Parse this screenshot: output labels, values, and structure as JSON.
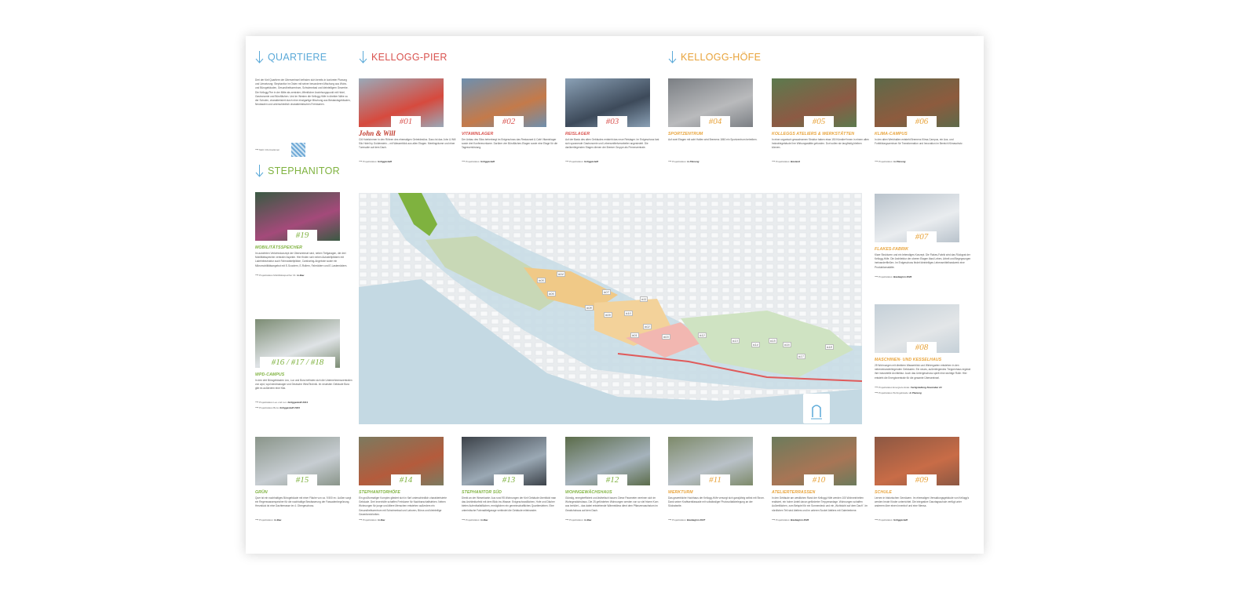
{
  "sections": {
    "quartiere": "QUARTIERE",
    "stephanitor": "STEPHANITOR",
    "kellogg_pier": "KELLOGG-PIER",
    "kellogg_hoefe": "KELLOGG-HÖFE"
  },
  "intro": {
    "text": "Drei der fünf Quartiere der Überseeinsel befinden sich bereits in konkreter Planung und Umsetzung: Stephanitor im Osten mit seiner besonderen Mischung aus Wohn- und Bürogebäuden, Gesundheitszentrum, Schwimmbad und kleinteiligem Gewerbe. Die Kellogg-Pier in der Mitte als zentraler, öffentlicher Anziehungspunkt mit Hotel, Gastronomie und Büroflächen. Und im Westen die Kellogg-Höfe in direkter Nähe zu der Schulen, charakterisiert durch eine einzigartige Mischung aus Bestandsgebäuden, Neubauten und unterschiedlich charakteristischen Freiräumen.",
    "more": "Mehr Informationen"
  },
  "projects": [
    {
      "num": "#01",
      "title": "John & Will",
      "logo": true,
      "desc": "Citi Hotelzimmer in den Röhren des ehemaligen Getreidesilos. Dazu ist das John & Will Silo Hotel by Goldenstein – mit Wasserblick aus allen Etagen. Meetingräume und einer Turmsuite auf dem Dach.",
      "status_label": "Projektstatus:",
      "status": "fertiggestellt"
    },
    {
      "num": "#02",
      "title": "VITAMINLAGER",
      "desc": "Der Anbau des Silos beherbergt im Erdgeschoss das Restaurant & Café Vitaminlager sowie drei Konferenzräume. Darüber vier Büroflächen-Etagen sowie eine Etage für die Tagesverköstung.",
      "status_label": "Projektstatus:",
      "status": "fertiggestellt"
    },
    {
      "num": "#03",
      "title": "REISLAGER",
      "desc": "Auf der Basis des alten Gebäudes entsteht das neue Reislager. Im Erdgeschoss fast sich spannende Gastronomie und Lebensmittelverarbeiter angesiedelt. Die darüberliegenden Etagen dienen der Bremer Gruppe als Firmenzentrale.",
      "status_label": "Projektstatus:",
      "status": "fertiggestellt"
    },
    {
      "num": "#04",
      "title": "SPORTZENTRUM",
      "desc": "Auf zwei Etagen mit acht Hallen wird Bremens 1860 ein Sportzentrum betreiben.",
      "status_label": "Projektstatus:",
      "status": "in Planung"
    },
    {
      "num": "#05",
      "title": "KOLLEGGS ATELIERS & WERKSTÄTTEN",
      "desc": "In einer organisch gewachsenen Struktur haben etwa 150 Künstler*innen in einem alten Industriegebäude ihre Wirkungsstätte gefunden. Dort sollen sie langfristig bleiben können.",
      "status_label": "Projektstatus:",
      "status": "Bestand"
    },
    {
      "num": "#06",
      "title": "KLIMA-CAMPUS",
      "desc": "In den alten Werkhallen entsteht Bremens Klima-Campus, ein Aus- und Fortbildungszentrum für Transformation und Innovation im Bereich Klimaschutz.",
      "status_label": "Projektstatus:",
      "status": "in Planung"
    },
    {
      "num": "#07",
      "title": "FLAKES-FABRIK",
      "desc": "Klare Strukturen und ein lebendiges Konzept. Die Flakes-Fabrik wird das Rückgrat der Kellogg-Höfe. Die Architektur der oberen Etagen lässt Leben, Arbeit und Begegnungen ineinanderfließen. Im Erdgeschoss findet kleinteiliges Lebensmittelhandwerk eine Produktionsstätte.",
      "status_label": "Projektstatus:",
      "status": "Baubeginn 2026"
    },
    {
      "num": "#08",
      "title": "MASCHINEN- UND KESSELHAUS",
      "desc": "25 Wohnungen mit direktem Wasserblick und Wintergarten entstehen in den nebeneinanderliegenden Gebäuden. Ein neues, außenliegendes Treppenhaus ergänzt ihre industrielle Architektur. Auch das Untergeschoss spielt eine wichtige Rolle: Hier entsteht die Energiezentrale für die gesamte Überseeinsel.",
      "status_label": "Projektstatus Energiezentrale:",
      "status": "Fertigstellung November 24",
      "status2_label": "Projektstatus Wohngebäude:",
      "status2": "in Planung"
    },
    {
      "num": "#09",
      "title": "SCHULE",
      "desc": "Lernen in historischen Gemäuern. Im ehemaligen Verwaltungsgebäude von Kellogg's werden heute Kinder unterrichtet. Die integrative Ganztagsschule verfügt unter anderem über einen Innenhof und eine Mensa.",
      "status_label": "Projektstatus:",
      "status": "fertiggestellt"
    },
    {
      "num": "#10",
      "title": "ATELIERTERRASSEN",
      "desc": "In den Gebäude am westlichen Rand der Kellogg-Höfe werden 100 Wohneinheiten realisiert, ein hoher Anteil davon geförderter Treppenanlage. Wohnungen schaffen Außenflächen, zum Beispiel für ein Sonnendeck und ein „Wohlsicht auf dem Dach\". Im nördlichen Teil sind Ateliers und im unteren Sockel Ateliers mit Galerieebene.",
      "status_label": "Projektstatus:",
      "status": "Baubeginn 2026"
    },
    {
      "num": "#11",
      "title": "WERKTURM",
      "desc": "Das gewerbliche Hochhaus der Kellogg-Höfe versorgt sich ganzjährig selbst mit Strom. Dank seiner Kraftwerkfassade mit vollständiger Photovoltaikbelegung an der Südostseite.",
      "status_label": "Projektstatus:",
      "status": "Baubeginn 2027"
    },
    {
      "num": "#12",
      "title": "WOHNGEWÄCHSHAUS",
      "desc": "Günstig, energieeffizient und ästhetisch bauen: Diese Parameter vereinen sich im Wohngewächshaus. Die 25 geförderten Wohnungen werden von so viel frisem Korn aus behütet – das dabei entstehende Wärmeklima dient dem Pflanzenwachstum im Gewächshaus auf dem Dach.",
      "status_label": "Projektstatus:",
      "status": "in Bau"
    },
    {
      "num": "#13",
      "title": "STEPHANITOR SÜD",
      "desc": "Direkt an der Weserkante: Aus rund 95 Wohnungen der fünf Gebäude überblickt man das Architekturfeld mit dem Blick ins Wasser. Erdgeschossflächen, Hofe und Dächer bieten Aufenthaltsflächen, ermöglichen ein gemeinschaftliches Quartiersleben. Eine unterirdische Fahrradtiefgarage verbindet die Gebäude miteinander.",
      "status_label": "Projektstatus:",
      "status": "in Bau"
    },
    {
      "num": "#14",
      "title": "STEPHANITORHÖFE",
      "desc": "Ein großformatiger Komplex gliedert sich in fünf unterschiedlich charakterisierte Gebäude. Drei Innenhöfe schaffen Freiräume für Nachbarschaftsleben. Neben Wohnungen für junge und ältere Menschen entstehen außerdem ein Gesundheitszentrum mit Schwimmbad und Laboren, Büros und kleinteilige Gewerbeeinheiten.",
      "status_label": "Projektstatus:",
      "status": "in Bau"
    },
    {
      "num": "#15",
      "title": "GRÜN",
      "desc": "Quer ist ein nachhaltiges Bürogebäude mit einer Fläche von ca. 9.500 m². Außen sorgt ein Regenwasserspeicher für die nachhaltige Bewässerung der Fassadenbegrünung. Herzstück ist eine Dachterrasse im 4. Obergeschoss.",
      "status_label": "Projektstatus:",
      "status": "in Bau"
    },
    {
      "num": "#16 / #17 / #18",
      "title": "WPD-CAMPUS",
      "desc": "In den drei Bürogebäuden Leo, Lux und Bora befinden sich die Unternehmenszentralen von wpd, wpd windmanager und Deutsche WindTechnik. Im neuesten Gebäude Bora gibt es außerdem eine Kita.",
      "status_label": "Projektstatus Leo und Lux:",
      "status": "fertiggestellt 2013",
      "status2_label": "Projektstatus Bora:",
      "status2": "fertiggestellt 2024"
    },
    {
      "num": "#19",
      "title": "MOBILITÄTSSPEICHER",
      "desc": "Im autofreien Verkehrskonzept der Überseeinsel sind, neben Tiefgaragen, die drei Mobilitätsspeicher zentraler Aspekte. Hier finden sich neben Autostellplätzen mit Ladeinfrastruktur auch Fahrradstellplätze, Carsharing-Angebote sowie ein Mikromobilitätsangebot mit E-Scootern, E-Rollern, Fahrrädern und E-Lastenrädern.",
      "status_label": "Projektstatus Mobilitätsspeicher 01:",
      "status": "in Bau"
    }
  ],
  "map": {
    "labels": [
      "#04",
      "#05",
      "#06",
      "#07",
      "#08",
      "#09",
      "#10",
      "#01",
      "#02",
      "#03",
      "#11",
      "#12",
      "#13",
      "#14",
      "#15",
      "#16",
      "#17",
      "#18"
    ]
  },
  "colors": {
    "quartiere": "#5aa9d8",
    "stephanitor": "#7fb23f",
    "kellogg_pier": "#d9534f",
    "kellogg_hoefe": "#e8a33a"
  }
}
